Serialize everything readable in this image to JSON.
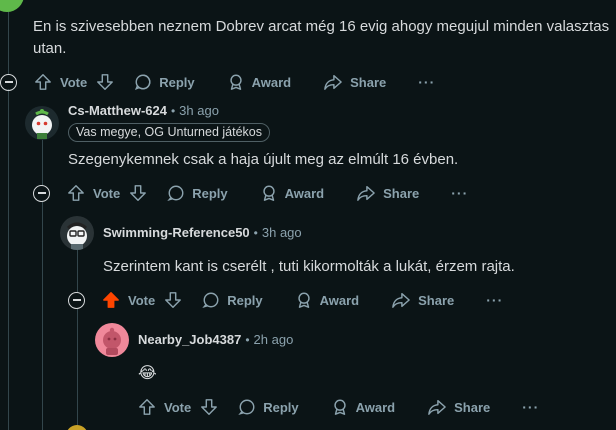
{
  "comments": [
    {
      "username": "",
      "time": "",
      "body_lines": [
        "En is szivesebben neznem Dobrev arcat még 16 evig ahogy megujul minden valasztas",
        "utan."
      ]
    },
    {
      "username": "Cs-Matthew-624",
      "time": "3h ago",
      "flair": "Vas megye, OG Unturned játékos",
      "body": "Szegenykemnek csak a haja újult meg az elmúlt 16 évben."
    },
    {
      "username": "Swimming-Reference50",
      "time": "3h ago",
      "body": "Szerintem kant is cserélt , tuti kikormolták a lukát, érzem rajta."
    },
    {
      "username": "Nearby_Job4387",
      "time": "2h ago",
      "body": "😂"
    }
  ],
  "actions": {
    "vote": "Vote",
    "reply": "Reply",
    "award": "Award",
    "share": "Share",
    "more": "···"
  },
  "separator": "•",
  "colors": {
    "background": "#0b1416",
    "text": "#d7dadc",
    "muted": "#8ba2ad",
    "thread_line": "#33464c",
    "upvote_active": "#ff4500"
  }
}
